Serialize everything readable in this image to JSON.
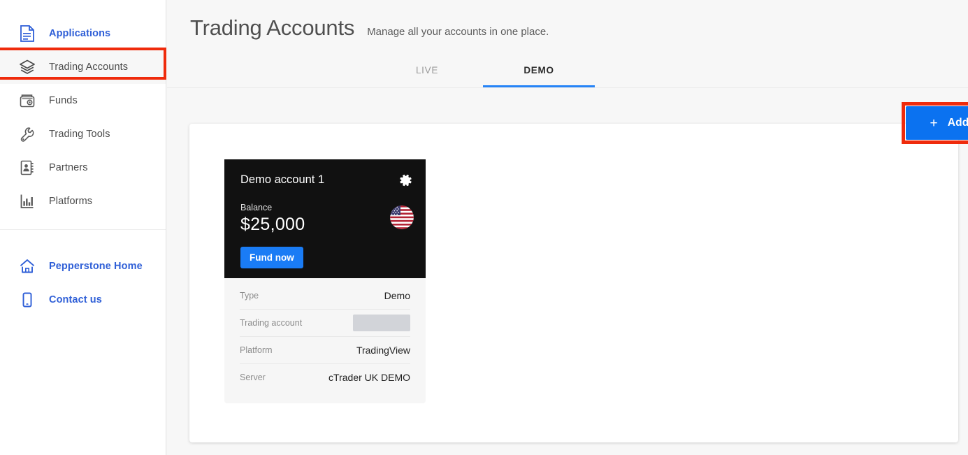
{
  "sidebar": {
    "primary_items": [
      {
        "label": "Applications",
        "icon": "document-icon",
        "style": "link"
      },
      {
        "label": "Trading Accounts",
        "icon": "layers-icon",
        "style": "active"
      },
      {
        "label": "Funds",
        "icon": "wallet-icon",
        "style": "normal"
      },
      {
        "label": "Trading Tools",
        "icon": "wrench-icon",
        "style": "normal"
      },
      {
        "label": "Partners",
        "icon": "address-book-icon",
        "style": "normal"
      },
      {
        "label": "Platforms",
        "icon": "bar-chart-icon",
        "style": "normal"
      }
    ],
    "secondary_items": [
      {
        "label": "Pepperstone Home",
        "icon": "home-icon",
        "style": "link"
      },
      {
        "label": "Contact us",
        "icon": "phone-icon",
        "style": "link"
      }
    ]
  },
  "header": {
    "title": "Trading Accounts",
    "subtitle": "Manage all your accounts in one place.",
    "tabs": [
      {
        "label": "LIVE",
        "active": false
      },
      {
        "label": "DEMO",
        "active": true
      }
    ]
  },
  "toolbar": {
    "add_account_label": "Add a trading account",
    "add_account_plus": "+"
  },
  "account": {
    "name": "Demo account 1",
    "balance_label": "Balance",
    "balance_value": "$25,000",
    "fund_now_label": "Fund now",
    "flag": "us-flag-icon",
    "settings_icon": "gear-icon",
    "details": [
      {
        "key": "Type",
        "value": "Demo",
        "redacted": false
      },
      {
        "key": "Trading account",
        "value": "",
        "redacted": true
      },
      {
        "key": "Platform",
        "value": "TradingView",
        "redacted": false
      },
      {
        "key": "Server",
        "value": "cTrader UK DEMO",
        "redacted": false
      }
    ]
  },
  "colors": {
    "accent_blue": "#0b72f0",
    "link_blue": "#2f5fd7",
    "tab_underline": "#2684f7",
    "annotation_red": "#ef2b0c",
    "card_dark": "#111111"
  }
}
